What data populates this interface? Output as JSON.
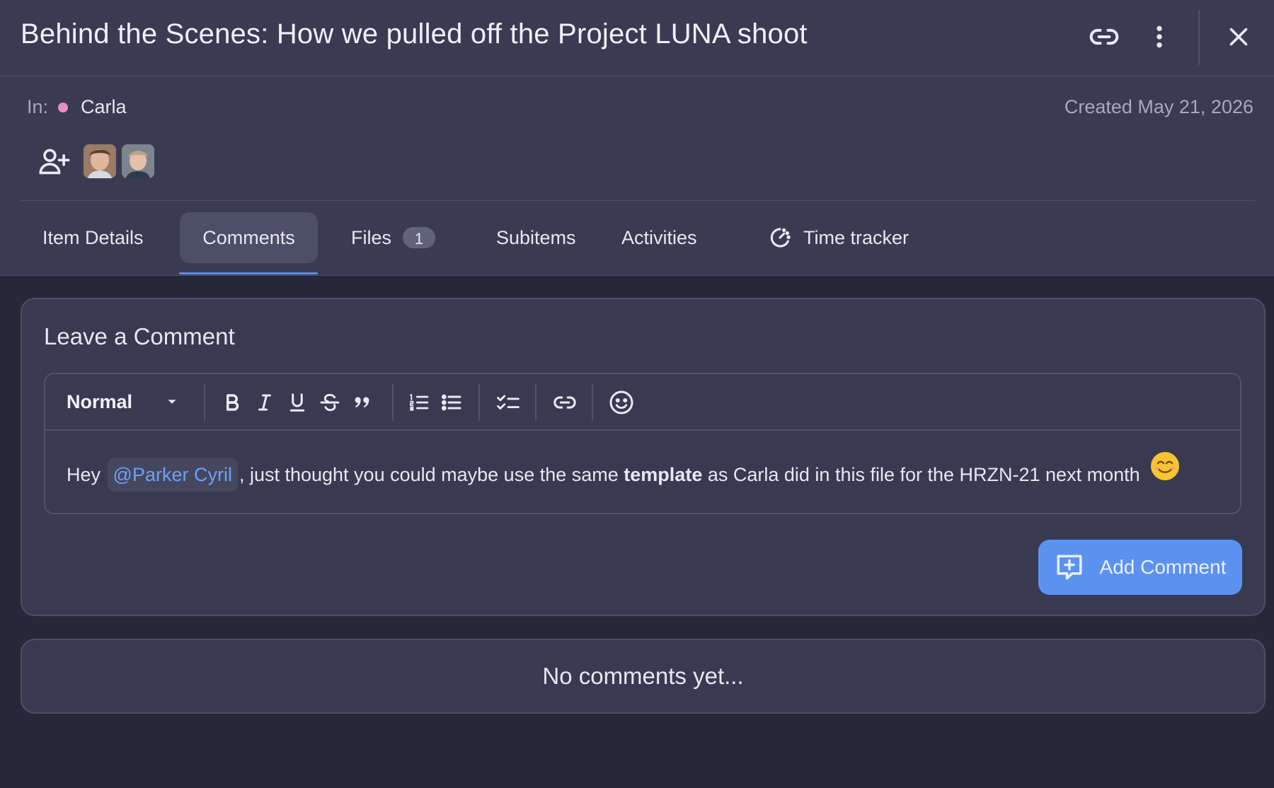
{
  "header": {
    "title": "Behind the Scenes: How we pulled off the Project LUNA shoot",
    "copy_link_icon": "link-icon",
    "more_icon": "more-vertical-icon",
    "close_icon": "close-icon"
  },
  "meta": {
    "in_label": "In:",
    "workspace": "Carla",
    "workspace_color": "#e88fc8",
    "created": "Created May 21, 2026"
  },
  "people": {
    "add_icon": "add-user-icon",
    "avatars": [
      "avatar-1",
      "avatar-2"
    ]
  },
  "tabs": [
    {
      "label": "Item Details",
      "active": false
    },
    {
      "label": "Comments",
      "active": true
    },
    {
      "label": "Files",
      "badge": "1",
      "active": false
    },
    {
      "label": "Subitems",
      "active": false
    },
    {
      "label": "Activities",
      "active": false
    },
    {
      "label": "Time tracker",
      "icon": "time-tracker-icon",
      "active": false
    }
  ],
  "comment_form": {
    "title": "Leave a Comment",
    "format_select": "Normal",
    "toolbar_icons": [
      "bold-icon",
      "italic-icon",
      "underline-icon",
      "strikethrough-icon",
      "quote-icon",
      "ordered-list-icon",
      "bullet-list-icon",
      "checklist-icon",
      "link-icon",
      "emoji-icon"
    ],
    "body": {
      "prefix": "Hey",
      "mention": "@Parker Cyril",
      "middle": ", just thought you could maybe use the same",
      "bold": "template",
      "suffix": "as Carla did in this file for the HRZN-21 next month",
      "emoji": "smiling-face-emoji"
    },
    "submit_label": "Add Comment",
    "submit_icon": "add-comment-icon",
    "accent": "#5b92f0"
  },
  "comments": {
    "empty_text": "No comments yet..."
  }
}
